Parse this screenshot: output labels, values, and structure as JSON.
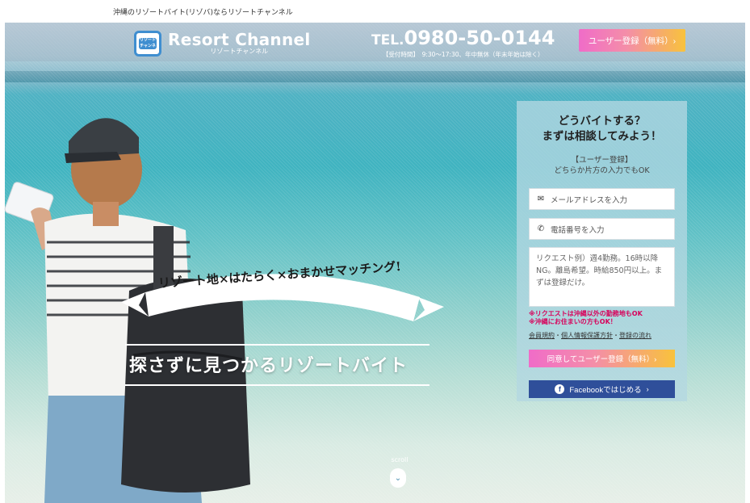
{
  "top_strip": {
    "text": "沖縄のリゾートバイト(リゾバ)ならリゾートチャンネル"
  },
  "header": {
    "logo_name": "Resort Channel",
    "logo_sub": "リゾートチャンネル",
    "logo_icon_text": "リゾート チャンネル",
    "tel_prefix": "TEL.",
    "tel_number": "0980-50-0144",
    "tel_hours": "【受付時間】　9:30〜17:30、年中無休（年末年始は除く）",
    "register_button": "ユーザー登録（無料）›"
  },
  "hero": {
    "ribbon_text": "リゾート地×はたらく×おまかせマッチング!",
    "headline": "探さずに見つかるリゾートバイト",
    "scroll_label": "scroll",
    "scroll_icon": "⌄"
  },
  "form": {
    "title_line1": "どうバイトする？",
    "title_line2": "まずは相談してみよう！",
    "sub_line1": "【ユーザー登録】",
    "sub_line2": "どちらか片方の入力でもOK",
    "email_placeholder": "メールアドレスを入力",
    "email_icon": "✉",
    "phone_placeholder": "電話番号を入力",
    "phone_icon": "✆",
    "request_placeholder": "リクエスト例）週4勤務。16時以降NG。離島希望。時給850円以上。まずは登録だけ。",
    "note_line1": "※リクエストは沖縄以外の勤務地もOK",
    "note_line2": "※沖縄にお住まいの方もOK！",
    "link_terms": "会員規約",
    "link_privacy": "個人情報保護方針",
    "link_flow": "登録の流れ",
    "link_sep": "・",
    "agree_button": "同意してユーザー登録（無料）›",
    "facebook_button": "Facebookではじめる",
    "facebook_icon": "f",
    "facebook_chevron": "›"
  },
  "colors": {
    "accent_gradient_start": "#f06cc8",
    "accent_gradient_end": "#f8c23c",
    "facebook_blue": "#2f4f9a",
    "note_red": "#d8005a",
    "logo_blue": "#3f8ed0"
  }
}
